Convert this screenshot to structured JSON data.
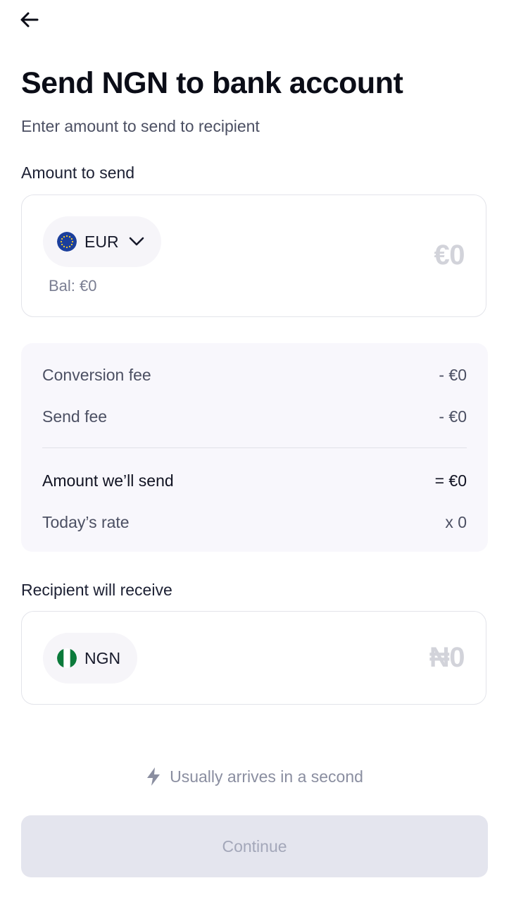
{
  "header": {
    "back_icon": "arrow-left-icon"
  },
  "page": {
    "title": "Send NGN to bank account",
    "subtitle": "Enter amount to send to recipient"
  },
  "send": {
    "label": "Amount to send",
    "currency_code": "EUR",
    "currency_flag": "eu-flag-icon",
    "balance": "Bal: €0",
    "amount_placeholder": "€0"
  },
  "fees": {
    "conversion_fee_label": "Conversion fee",
    "conversion_fee_value": "- €0",
    "send_fee_label": "Send fee",
    "send_fee_value": "- €0",
    "amount_send_label": "Amount we’ll send",
    "amount_send_value": "= €0",
    "rate_label": "Today’s rate",
    "rate_value": "x 0"
  },
  "receive": {
    "label": "Recipient will receive",
    "currency_code": "NGN",
    "currency_flag": "ng-flag-icon",
    "amount_placeholder": "₦0"
  },
  "footer": {
    "arrival_text": "Usually arrives in a second",
    "arrival_icon": "lightning-icon",
    "continue_label": "Continue"
  },
  "colors": {
    "accent_disabled_bg": "#e4e5ee",
    "eu_blue": "#1b3f9c",
    "ng_green": "#0b7a3b"
  }
}
